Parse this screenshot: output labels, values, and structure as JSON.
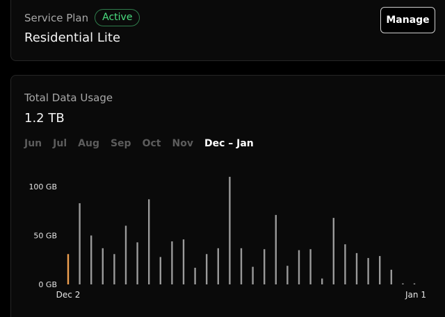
{
  "plan": {
    "label": "Service Plan",
    "status": "Active",
    "name": "Residential Lite",
    "manage_label": "Manage"
  },
  "usage": {
    "title": "Total Data Usage",
    "total": "1.2 TB",
    "tabs": [
      {
        "label": "Jun",
        "active": false
      },
      {
        "label": "Jul",
        "active": false
      },
      {
        "label": "Aug",
        "active": false
      },
      {
        "label": "Sep",
        "active": false
      },
      {
        "label": "Oct",
        "active": false
      },
      {
        "label": "Nov",
        "active": false
      },
      {
        "label": "Dec – Jan",
        "active": true
      }
    ]
  },
  "colors": {
    "bar": "#9a9a9a",
    "bar_highlight": "#f0a050",
    "active_badge": "#4ade80"
  },
  "chart_data": {
    "type": "bar",
    "y_unit": "GB",
    "ylim": [
      0,
      100
    ],
    "yticks": [
      "100 GB",
      "50 GB",
      "0 GB"
    ],
    "x_labels": [
      "Dec 2",
      "Jan 1"
    ],
    "highlight_index": 0,
    "values": [
      31,
      83,
      50,
      37,
      31,
      60,
      43,
      87,
      28,
      44,
      46,
      17,
      31,
      37,
      110,
      37,
      18,
      36,
      71,
      19,
      35,
      36,
      6,
      68,
      41,
      32,
      27,
      29,
      15,
      1,
      1
    ]
  }
}
